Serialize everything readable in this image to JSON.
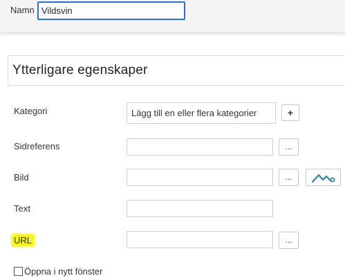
{
  "top": {
    "name_label": "Namn",
    "name_value": "Vildsvin"
  },
  "section": {
    "title": "Ytterligare egenskaper"
  },
  "fields": {
    "category": {
      "label": "Kategori",
      "value": "Lägg till en eller flera kategorier",
      "add_label": "+"
    },
    "page_reference": {
      "label": "Sidreferens",
      "value": "",
      "browse_label": "..."
    },
    "image": {
      "label": "Bild",
      "value": "",
      "browse_label": "...",
      "preview_icon": "image-mountain-icon"
    },
    "text": {
      "label": "Text",
      "value": ""
    },
    "url": {
      "label": "URL",
      "value": "",
      "browse_label": "...",
      "highlight_color": "#f5f21f"
    }
  },
  "new_window": {
    "label": "Öppna i nytt fönster",
    "checked": false
  },
  "colors": {
    "focus_border": "#2a6fd6",
    "icon_teal": "#3a8ca6"
  }
}
